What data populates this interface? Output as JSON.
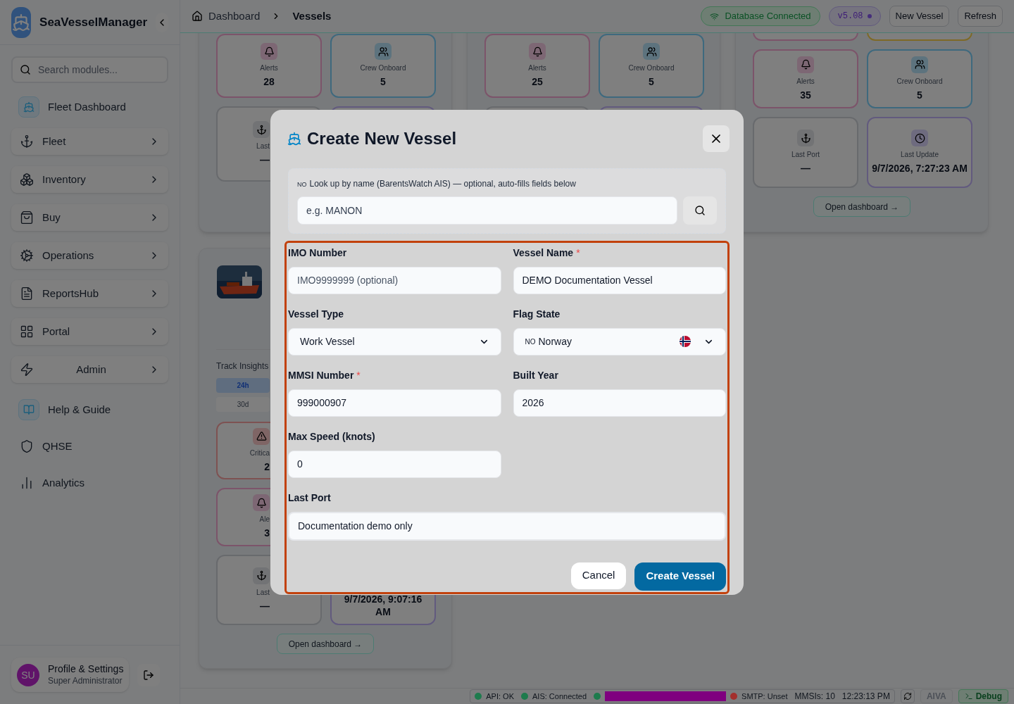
{
  "sidebar": {
    "brand": "SeaVesselManager",
    "search_placeholder": "Search modules...",
    "items": [
      {
        "label": "Fleet Dashboard",
        "kind": "boxed"
      },
      {
        "label": "Fleet",
        "kind": "card"
      },
      {
        "label": "Inventory",
        "kind": "card"
      },
      {
        "label": "Buy",
        "kind": "card"
      },
      {
        "label": "Operations",
        "kind": "card"
      },
      {
        "label": "ReportsHub",
        "kind": "card"
      },
      {
        "label": "Portal",
        "kind": "card"
      },
      {
        "label": "Admin",
        "kind": "card-center"
      },
      {
        "label": "Help & Guide",
        "kind": "boxed"
      },
      {
        "label": "QHSE",
        "kind": "plain"
      },
      {
        "label": "Analytics",
        "kind": "plain"
      }
    ],
    "profile": {
      "initials": "SU",
      "name": "Profile & Settings",
      "role": "Super Administrator"
    }
  },
  "header": {
    "breadcrumb": [
      "Dashboard",
      "Vessels"
    ],
    "db_status": "Database Connected",
    "version": "v5.08",
    "buttons": [
      "New Vessel",
      "Refresh"
    ]
  },
  "background": {
    "panel_a": {
      "tiles": [
        {
          "kind": "alerts",
          "label": "Alerts",
          "value": "28"
        },
        {
          "kind": "crew",
          "label": "Crew Onboard",
          "value": "5"
        },
        {
          "kind": "port",
          "label": "Last",
          "value": "—"
        }
      ]
    },
    "panel_b": {
      "track_title": "Track Insights",
      "ranges": [
        {
          "label": "24h",
          "selected": true
        },
        {
          "label": "30d",
          "selected": false
        }
      ],
      "tiles": [
        {
          "kind": "critical",
          "label": "Critica",
          "value": "2"
        },
        {
          "kind": "alerts",
          "label": "Ale",
          "value": "3"
        },
        {
          "kind": "port",
          "label": "Last",
          "value": "—"
        }
      ],
      "last_update": [
        "9/7/2026, 9:07:16",
        "AM"
      ],
      "button": "Open dashboard →"
    },
    "panel_c": {
      "tiles": [
        {
          "kind": "alerts",
          "label": "Alerts",
          "value": "25"
        },
        {
          "kind": "crew",
          "label": "Crew Onboard",
          "value": "5"
        }
      ]
    },
    "panel_d": {
      "tiles": [
        {
          "kind": "alerts",
          "label": "Alerts",
          "value": "35"
        },
        {
          "kind": "crew",
          "label": "Crew Onboard",
          "value": "5"
        },
        {
          "kind": "port",
          "label": "Last Port",
          "value": "—"
        },
        {
          "kind": "update",
          "label": "Last Update",
          "value": "9/7/2026, 7:27:23 AM"
        }
      ],
      "button": "Open dashboard →"
    }
  },
  "modal": {
    "title": "Create New Vessel",
    "required_mark": "*",
    "lookup": {
      "code": "NO",
      "label": "Look up by name (BarentsWatch AIS) — optional, auto-fills fields below",
      "placeholder": "e.g. MANON"
    },
    "fields": [
      {
        "label": "IMO Number",
        "kind": "text",
        "required": false,
        "placeholder": "IMO9999999 (optional)"
      },
      {
        "label": "Vessel Name",
        "kind": "text",
        "required": true,
        "value": "DEMO Documentation Vessel"
      },
      {
        "label": "Vessel Type",
        "kind": "select",
        "required": false,
        "value": "Work Vessel"
      },
      {
        "label": "Flag State",
        "kind": "flag-select",
        "required": false,
        "code": "NO",
        "value": "Norway"
      },
      {
        "label": "MMSI Number",
        "kind": "text",
        "required": true,
        "value": "999000907"
      },
      {
        "label": "Built Year",
        "kind": "text",
        "required": false,
        "value": "2026"
      },
      {
        "label": "Max Speed (knots)",
        "kind": "text",
        "required": false,
        "value": "0"
      },
      {
        "label": "Last Port",
        "kind": "wide",
        "required": false,
        "value": "Documentation demo only",
        "focused": true
      }
    ],
    "buttons": [
      {
        "label": "Cancel",
        "kind": "secondary"
      },
      {
        "label": "Create Vessel",
        "kind": "primary"
      }
    ]
  },
  "status_bar": {
    "items": [
      {
        "label": "API: OK",
        "color": "#1e7b4d"
      },
      {
        "label": "AIS: Connected",
        "color": "#1e7b4d"
      },
      {
        "color": "#1e7b4d",
        "kind": "redacted"
      },
      {
        "label": "SMTP: Unset",
        "color": "#a3302d"
      }
    ],
    "mmsis": "MMSIs: 10",
    "time": "12:23:13 PM",
    "aiva": {
      "label": "AIVA",
      "disabled": true
    },
    "debug": "Debug"
  }
}
